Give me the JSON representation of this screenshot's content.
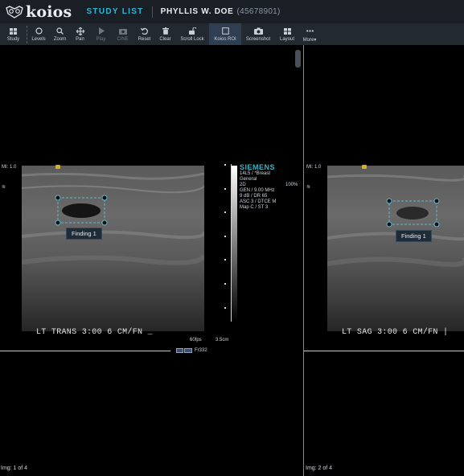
{
  "header": {
    "logo_text": "koios",
    "study_list": "STUDY LIST",
    "patient_name": "PHYLLIS W. DOE",
    "patient_id": "(45678901)"
  },
  "toolbar": [
    {
      "label": "Study",
      "icon": "grid-icon",
      "state": "normal"
    },
    {
      "label": "Levels",
      "icon": "levels-icon",
      "state": "normal"
    },
    {
      "label": "Zoom",
      "icon": "search-icon",
      "state": "normal"
    },
    {
      "label": "Pan",
      "icon": "move-icon",
      "state": "normal"
    },
    {
      "label": "Play",
      "icon": "play-icon",
      "state": "disabled"
    },
    {
      "label": "CINE",
      "icon": "cine-icon",
      "state": "disabled"
    },
    {
      "label": "Reset",
      "icon": "reset-icon",
      "state": "normal"
    },
    {
      "label": "Clear",
      "icon": "trash-icon",
      "state": "normal"
    },
    {
      "label": "Scroll Lock",
      "icon": "unlock-icon",
      "state": "normal"
    },
    {
      "label": "Koios ROI",
      "icon": "roi-square-icon",
      "state": "active"
    },
    {
      "label": "Screenshot",
      "icon": "camera-icon",
      "state": "normal"
    },
    {
      "label": "Layout",
      "icon": "layout-icon",
      "state": "normal"
    },
    {
      "label": "More▾",
      "icon": "more-icon",
      "state": "normal"
    }
  ],
  "viewport1": {
    "mi": "MI: 1.0",
    "finding_label": "Finding 1",
    "caption": "LT TRANS 3:00 6 CM/FN _",
    "fps": "60fps",
    "depth": "3.5cm",
    "frame": "Fr332",
    "img_count": "Img: 1 of 4",
    "side_marker": "≋",
    "siemens": {
      "brand": "SIEMENS",
      "lines": [
        "14L5 / *Breast",
        "General",
        "2D",
        "GEN / 9.00 MHz",
        "9 dB / DR 65",
        "ASC 3 / DTCE M",
        "Map C / ST 3"
      ],
      "percent": "100%"
    }
  },
  "viewport2": {
    "mi": "MI:  1.0",
    "finding_label": "Finding 1",
    "caption": "LT SAG 3:00 6 CM/FN |",
    "img_count": "Img: 2 of 4",
    "side_marker": "≋"
  },
  "colors": {
    "accent": "#31b6d8",
    "roi": "#5fb8cc",
    "header_bg": "#1a1f26",
    "toolbar_bg": "#232931",
    "marker": "#d6b02a"
  }
}
